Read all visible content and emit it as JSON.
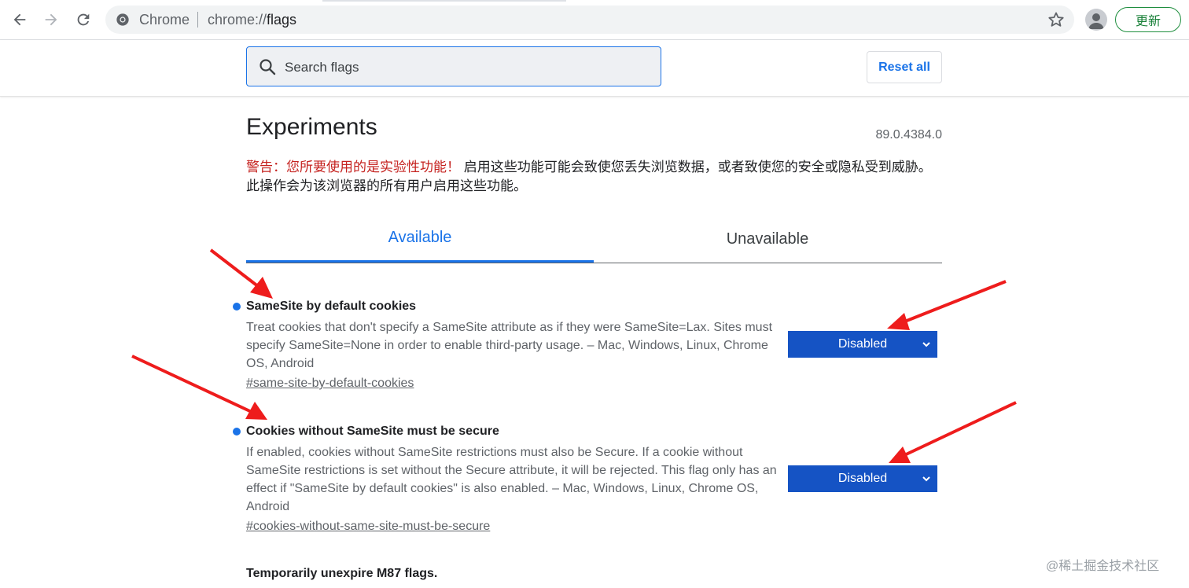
{
  "browser": {
    "site_label": "Chrome",
    "url_scheme": "chrome://",
    "url_path": "flags",
    "update_button": "更新"
  },
  "header": {
    "search_placeholder": "Search flags",
    "reset_label": "Reset all"
  },
  "main": {
    "title": "Experiments",
    "version": "89.0.4384.0",
    "warning_red": "警告：您所要使用的是实验性功能！",
    "warning_rest": " 启用这些功能可能会致使您丢失浏览数据，或者致使您的安全或隐私受到威胁。此操作会为该浏览器的所有用户启用这些功能。",
    "tabs": [
      {
        "label": "Available"
      },
      {
        "label": "Unavailable"
      }
    ],
    "flags": [
      {
        "name": "SameSite by default cookies",
        "description": "Treat cookies that don't specify a SameSite attribute as if they were SameSite=Lax. Sites must specify SameSite=None in order to enable third-party usage. – Mac, Windows, Linux, Chrome OS, Android",
        "link": "#same-site-by-default-cookies",
        "value": "Disabled"
      },
      {
        "name": "Cookies without SameSite must be secure",
        "description": "If enabled, cookies without SameSite restrictions must also be Secure. If a cookie without SameSite restrictions is set without the Secure attribute, it will be rejected. This flag only has an effect if \"SameSite by default cookies\" is also enabled. – Mac, Windows, Linux, Chrome OS, Android",
        "link": "#cookies-without-same-site-must-be-secure",
        "value": "Disabled"
      }
    ],
    "next_flag_name": "Temporarily unexpire M87 flags."
  },
  "watermark": "@稀土掘金技术社区",
  "colors": {
    "accent": "#1a73e8",
    "select_bg": "#1553c4",
    "warning_red": "#c5221f",
    "annotation_arrow": "#ee1c1c",
    "update_green": "#188038"
  }
}
